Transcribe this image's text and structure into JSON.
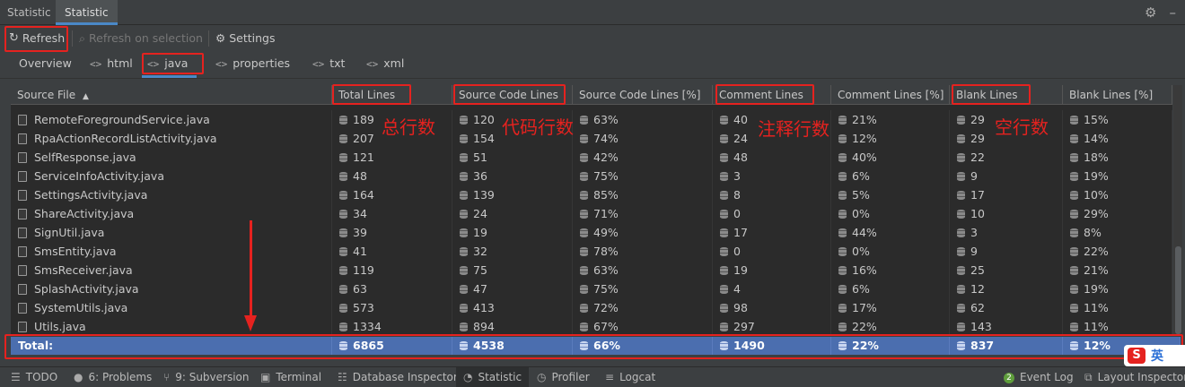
{
  "window": {
    "tabs": [
      "Statistic",
      "Statistic"
    ],
    "icons": [
      "gear-icon",
      "minimize-icon"
    ]
  },
  "toolbar": {
    "refresh": "Refresh",
    "refresh_on_selection": "Refresh on selection",
    "settings": "Settings"
  },
  "file_tabs": [
    "Overview",
    "html",
    "java",
    "properties",
    "txt",
    "xml"
  ],
  "active_file_tab": "java",
  "table": {
    "columns": [
      "Source File",
      "Total Lines",
      "Source Code Lines",
      "Source Code Lines [%]",
      "Comment Lines",
      "Comment Lines [%]",
      "Blank Lines",
      "Blank Lines [%]"
    ],
    "sort_column": "Source File",
    "rows": [
      [
        "RemoteForegroundService.java",
        "189",
        "120",
        "63%",
        "40",
        "21%",
        "29",
        "15%"
      ],
      [
        "RpaActionRecordListActivity.java",
        "207",
        "154",
        "74%",
        "24",
        "12%",
        "29",
        "14%"
      ],
      [
        "SelfResponse.java",
        "121",
        "51",
        "42%",
        "48",
        "40%",
        "22",
        "18%"
      ],
      [
        "ServiceInfoActivity.java",
        "48",
        "36",
        "75%",
        "3",
        "6%",
        "9",
        "19%"
      ],
      [
        "SettingsActivity.java",
        "164",
        "139",
        "85%",
        "8",
        "5%",
        "17",
        "10%"
      ],
      [
        "ShareActivity.java",
        "34",
        "24",
        "71%",
        "0",
        "0%",
        "10",
        "29%"
      ],
      [
        "SignUtil.java",
        "39",
        "19",
        "49%",
        "17",
        "44%",
        "3",
        "8%"
      ],
      [
        "SmsEntity.java",
        "41",
        "32",
        "78%",
        "0",
        "0%",
        "9",
        "22%"
      ],
      [
        "SmsReceiver.java",
        "119",
        "75",
        "63%",
        "19",
        "16%",
        "25",
        "21%"
      ],
      [
        "SplashActivity.java",
        "63",
        "47",
        "75%",
        "4",
        "6%",
        "12",
        "19%"
      ],
      [
        "SystemUtils.java",
        "573",
        "413",
        "72%",
        "98",
        "17%",
        "62",
        "11%"
      ],
      [
        "Utils.java",
        "1334",
        "894",
        "67%",
        "297",
        "22%",
        "143",
        "11%"
      ]
    ],
    "total": [
      "Total:",
      "6865",
      "4538",
      "66%",
      "1490",
      "22%",
      "837",
      "12%"
    ]
  },
  "annotations": {
    "total_lines": "总行数",
    "code_lines": "代码行数",
    "comment_lines": "注释行数",
    "blank_lines": "空行数"
  },
  "bottom_bar": {
    "todo": "TODO",
    "problems": "6: Problems",
    "subversion": "9: Subversion",
    "terminal": "Terminal",
    "database_inspector": "Database Inspector",
    "statistic": "Statistic",
    "profiler": "Profiler",
    "logcat": "Logcat",
    "event_log_count": "2",
    "event_log": "Event Log",
    "layout_inspector": "Layout Inspector"
  },
  "ime": {
    "logo": "S",
    "label": "英"
  },
  "colors": {
    "accent": "#4a88c7",
    "selection": "#4b6eaf",
    "annotation": "#e5221f"
  }
}
